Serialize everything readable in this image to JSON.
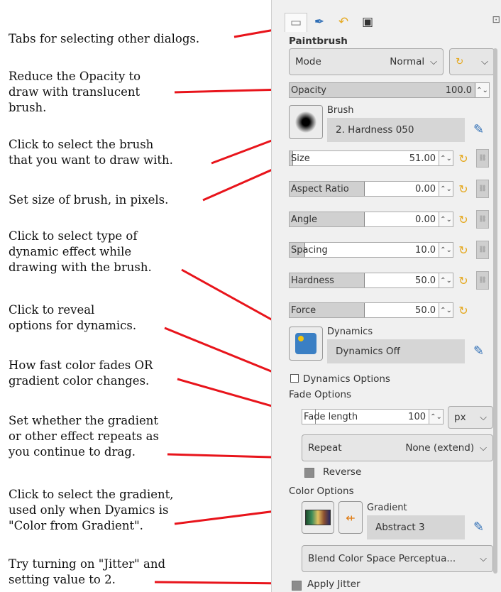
{
  "annotations": {
    "tabs": "Tabs for selecting other dialogs.",
    "opacity": "Reduce the Opacity to\ndraw with translucent\nbrush.",
    "brush": "Click to select the brush\nthat you want to draw with.",
    "size": "Set size of brush, in pixels.",
    "dynamics_type": "Click to select type of\ndynamic effect while\ndrawing with the brush.",
    "dynamics_options": "Click to reveal\noptions for dynamics.",
    "fade": "How fast color fades OR\ngradient color changes.",
    "repeat": "Set whether the gradient\nor other effect repeats as\nyou continue to drag.",
    "gradient": "Click to select the gradient,\nused only when Dyamics is\n\"Color from Gradient\".",
    "jitter": "Try turning on \"Jitter\" and\nsetting value to 2."
  },
  "panel": {
    "title": "Paintbrush",
    "mode": {
      "label": "Mode",
      "value": "Normal"
    },
    "opacity": {
      "label": "Opacity",
      "value": "100.0",
      "fraction": 1.0
    },
    "brush": {
      "label": "Brush",
      "name": "2. Hardness 050"
    },
    "sliders": [
      {
        "label": "Size",
        "value": "51.00",
        "fraction": 0.02
      },
      {
        "label": "Aspect Ratio",
        "value": "0.00",
        "fraction": 0.5
      },
      {
        "label": "Angle",
        "value": "0.00",
        "fraction": 0.5
      },
      {
        "label": "Spacing",
        "value": "10.0",
        "fraction": 0.1
      },
      {
        "label": "Hardness",
        "value": "50.0",
        "fraction": 0.5
      },
      {
        "label": "Force",
        "value": "50.0",
        "fraction": 0.5
      }
    ],
    "dynamics": {
      "label": "Dynamics",
      "name": "Dynamics Off"
    },
    "dynamics_options_label": "Dynamics Options",
    "fade_options_title": "Fade Options",
    "fade_length": {
      "label": "Fade length",
      "value": "100",
      "fraction": 0.1,
      "unit": "px"
    },
    "repeat": {
      "label": "Repeat",
      "value": "None (extend)"
    },
    "reverse_label": "Reverse",
    "color_options_title": "Color Options",
    "gradient": {
      "label": "Gradient",
      "name": "Abstract 3"
    },
    "blend_space": "Blend Color Space Perceptua...",
    "jitter_label": "Apply Jitter"
  },
  "colors": {
    "arrow": "#e8141b",
    "reset_icon": "#e5a81e",
    "edit_icon": "#2d6db5"
  }
}
